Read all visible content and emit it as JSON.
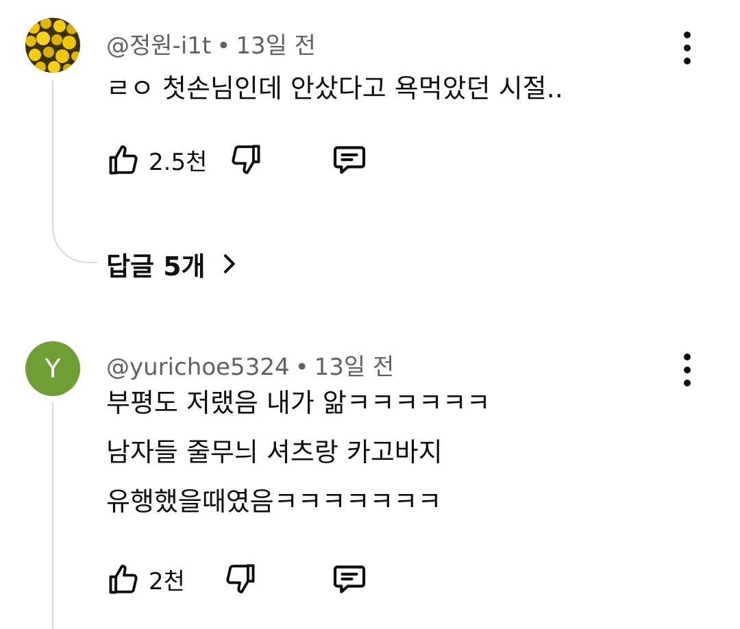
{
  "comments": [
    {
      "author": "@정원-i1t",
      "separator": "•",
      "time": "13일 전",
      "lines": [
        "ㄹㅇ 첫손님인데 안샀다고 욕먹았던 시절.."
      ],
      "likes": "2.5천",
      "avatar_color": "#d9b400",
      "replies_label": "답글 5개",
      "icons": [
        "thumb-up-icon",
        "thumb-down-icon",
        "reply-icon",
        "more-vertical-icon",
        "chevron-right-icon"
      ]
    },
    {
      "author": "@yurichoe5324",
      "separator": "•",
      "time": "13일 전",
      "avatar_letter": "Y",
      "avatar_color": "#6f9e35",
      "lines": [
        "부평도 저랬음 내가 앎ㅋㅋㅋㅋㅋㅋ",
        "남자들 줄무늬 셔츠랑 카고바지",
        "유행했을때였음ㅋㅋㅋㅋㅋㅋㅋ"
      ],
      "likes": "2천",
      "icons": [
        "thumb-up-icon",
        "thumb-down-icon",
        "reply-icon",
        "more-vertical-icon"
      ]
    }
  ]
}
